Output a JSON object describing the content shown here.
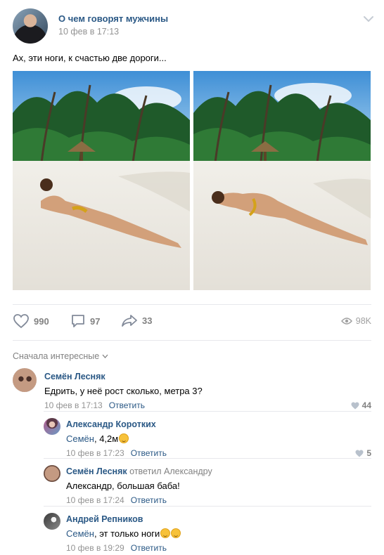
{
  "post": {
    "community_name": "О чем говорят мужчины",
    "date": "10 фев в 17:13",
    "text": "Ах, эти ноги, к счастью две дороги..."
  },
  "actions": {
    "likes": "990",
    "comments": "97",
    "shares": "33",
    "views": "98K"
  },
  "comments_sort": "Сначала интересные",
  "comments": [
    {
      "author": "Семён Лесняк",
      "text": "Едрить, у неё рост сколько, метра 3?",
      "date": "10 фев в 17:13",
      "reply_label": "Ответить",
      "likes": "44"
    },
    {
      "author": "Александр Коротких",
      "mention": "Семён",
      "text": ", 4,2м",
      "date": "10 фев в 17:23",
      "reply_label": "Ответить",
      "likes": "5"
    },
    {
      "author": "Семён Лесняк",
      "reply_to": "ответил Александру",
      "mention": "Александр",
      "text": ", большая баба!",
      "date": "10 фев в 17:24",
      "reply_label": "Ответить"
    },
    {
      "author": "Андрей Репников",
      "mention": "Семён",
      "text": ", эт только ноги",
      "date": "10 фев в 19:29",
      "reply_label": "Ответить"
    }
  ],
  "icons": {
    "like": "heart-icon",
    "comment": "speech-bubble-icon",
    "share": "share-arrow-icon",
    "views": "eye-icon",
    "more": "chevron-down-icon"
  },
  "colors": {
    "link": "#2a5885",
    "muted": "#939393",
    "divider": "#e7e8ec"
  }
}
